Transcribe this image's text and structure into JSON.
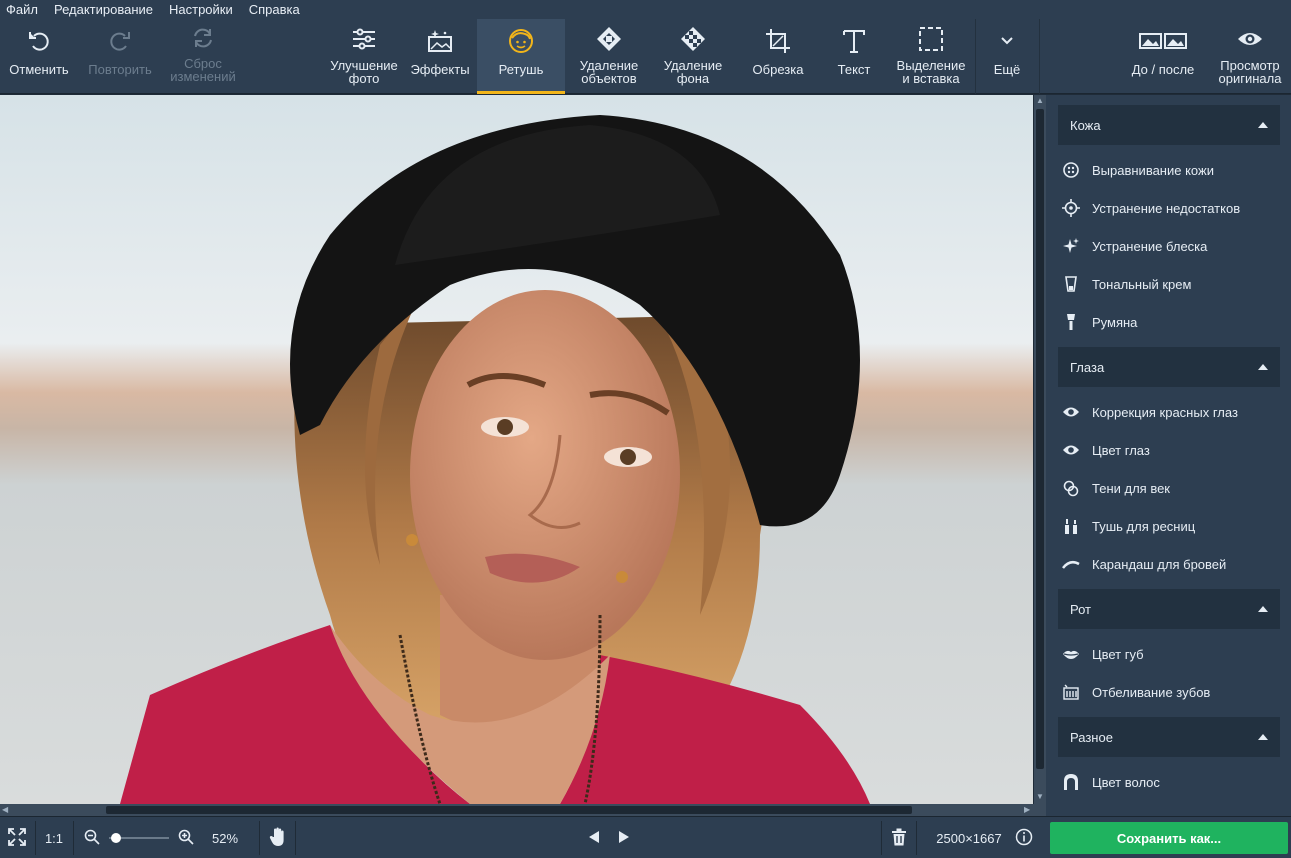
{
  "menu": [
    "Файл",
    "Редактирование",
    "Настройки",
    "Справка"
  ],
  "toolbar": {
    "undo": "Отменить",
    "redo": "Повторить",
    "reset": "Сброс\nизменений",
    "enhance": "Улучшение\nфото",
    "effects": "Эффекты",
    "retouch": "Ретушь",
    "remove_objects": "Удаление\nобъектов",
    "remove_bg": "Удаление\nфона",
    "crop": "Обрезка",
    "text": "Текст",
    "select_paste": "Выделение\nи вставка",
    "more": "Ещё",
    "before_after": "До / после",
    "view_original": "Просмотр\nоригинала"
  },
  "panel": {
    "skin": {
      "title": "Кожа",
      "items": [
        "Выравнивание кожи",
        "Устранение недостатков",
        "Устранение блеска",
        "Тональный крем",
        "Румяна"
      ]
    },
    "eyes": {
      "title": "Глаза",
      "items": [
        "Коррекция красных глаз",
        "Цвет глаз",
        "Тени для век",
        "Тушь для ресниц",
        "Карандаш для бровей"
      ]
    },
    "mouth": {
      "title": "Рот",
      "items": [
        "Цвет губ",
        "Отбеливание зубов"
      ]
    },
    "misc": {
      "title": "Разное",
      "items": [
        "Цвет волос"
      ]
    }
  },
  "status": {
    "ratio": "1:1",
    "zoom": "52%",
    "dimensions": "2500×1667",
    "save": "Сохранить как..."
  },
  "colors": {
    "accent": "#f2b51a",
    "save_button": "#1fb35f",
    "panel_bg": "#2d3e51"
  }
}
